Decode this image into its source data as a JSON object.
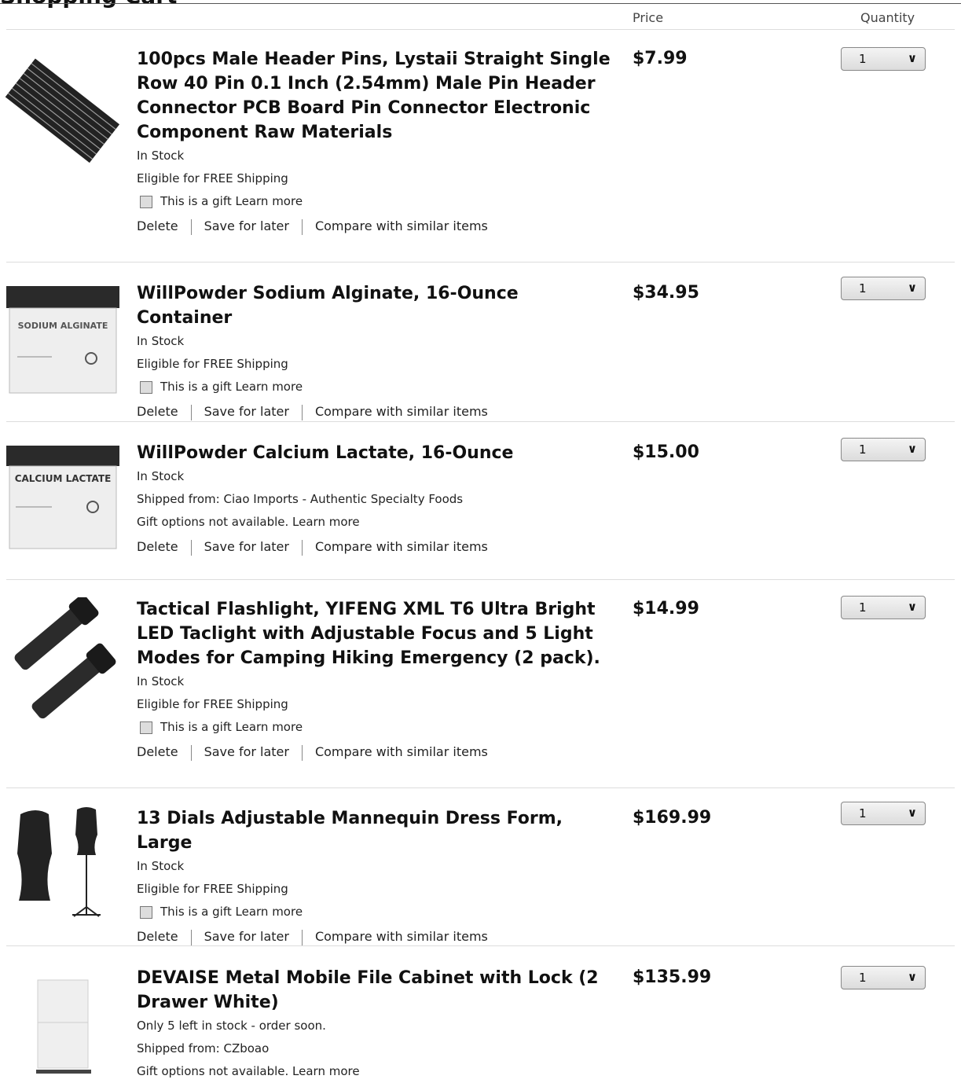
{
  "header": {
    "cut_title": "Shopping Cart",
    "price_label": "Price",
    "quantity_label": "Quantity"
  },
  "actions": {
    "delete": "Delete",
    "save": "Save for later",
    "compare": "Compare with similar items"
  },
  "gift": {
    "checkbox_label": "This is a gift",
    "learn_more": "Learn more"
  },
  "items": [
    {
      "title": "100pcs Male Header Pins, Lystaii Straight Single Row 40 Pin 0.1 Inch (2.54mm) Male Pin Header Connector PCB Board Pin Connector Electronic Component Raw Materials",
      "stock": "In Stock",
      "shipping": "Eligible for FREE Shipping",
      "price": "$7.99",
      "qty": "1",
      "thumb_icon": "header-pins-image"
    },
    {
      "title": "WillPowder Sodium Alginate, 16-Ounce Container",
      "stock": "In Stock",
      "shipping": "Eligible for FREE Shipping",
      "price": "$34.95",
      "qty": "1",
      "thumb_icon": "sodium-alginate-jar-image",
      "jar_label": "SODIUM ALGINATE"
    },
    {
      "title": "WillPowder Calcium Lactate, 16-Ounce",
      "stock": "In Stock",
      "shipped_from": "Shipped from: Ciao Imports - Authentic Specialty Foods",
      "gift_options": "Gift options not available. Learn more",
      "price": "$15.00",
      "qty": "1",
      "thumb_icon": "calcium-lactate-jar-image",
      "jar_label": "CALCIUM LACTATE"
    },
    {
      "title": "Tactical Flashlight, YIFENG XML T6 Ultra Bright LED Taclight with Adjustable Focus and 5 Light Modes for Camping Hiking Emergency (2 pack).",
      "stock": "In Stock",
      "shipping": "Eligible for FREE Shipping",
      "price": "$14.99",
      "qty": "1",
      "thumb_icon": "flashlight-pair-image"
    },
    {
      "title": "13 Dials Adjustable Mannequin Dress Form, Large",
      "stock": "In Stock",
      "shipping": "Eligible for FREE Shipping",
      "price": "$169.99",
      "qty": "1",
      "thumb_icon": "dress-form-image"
    },
    {
      "title": "DEVAISE Metal Mobile File Cabinet with Lock (2 Drawer White)",
      "stock": "Only 5 left in stock - order soon.",
      "shipped_from": "Shipped from: CZboao",
      "gift_options": "Gift options not available. Learn more",
      "price": "$135.99",
      "qty": "1",
      "thumb_icon": "file-cabinet-image"
    }
  ],
  "colors": {
    "text": "#111111",
    "rule": "#dddddd",
    "select_border": "#888888"
  }
}
